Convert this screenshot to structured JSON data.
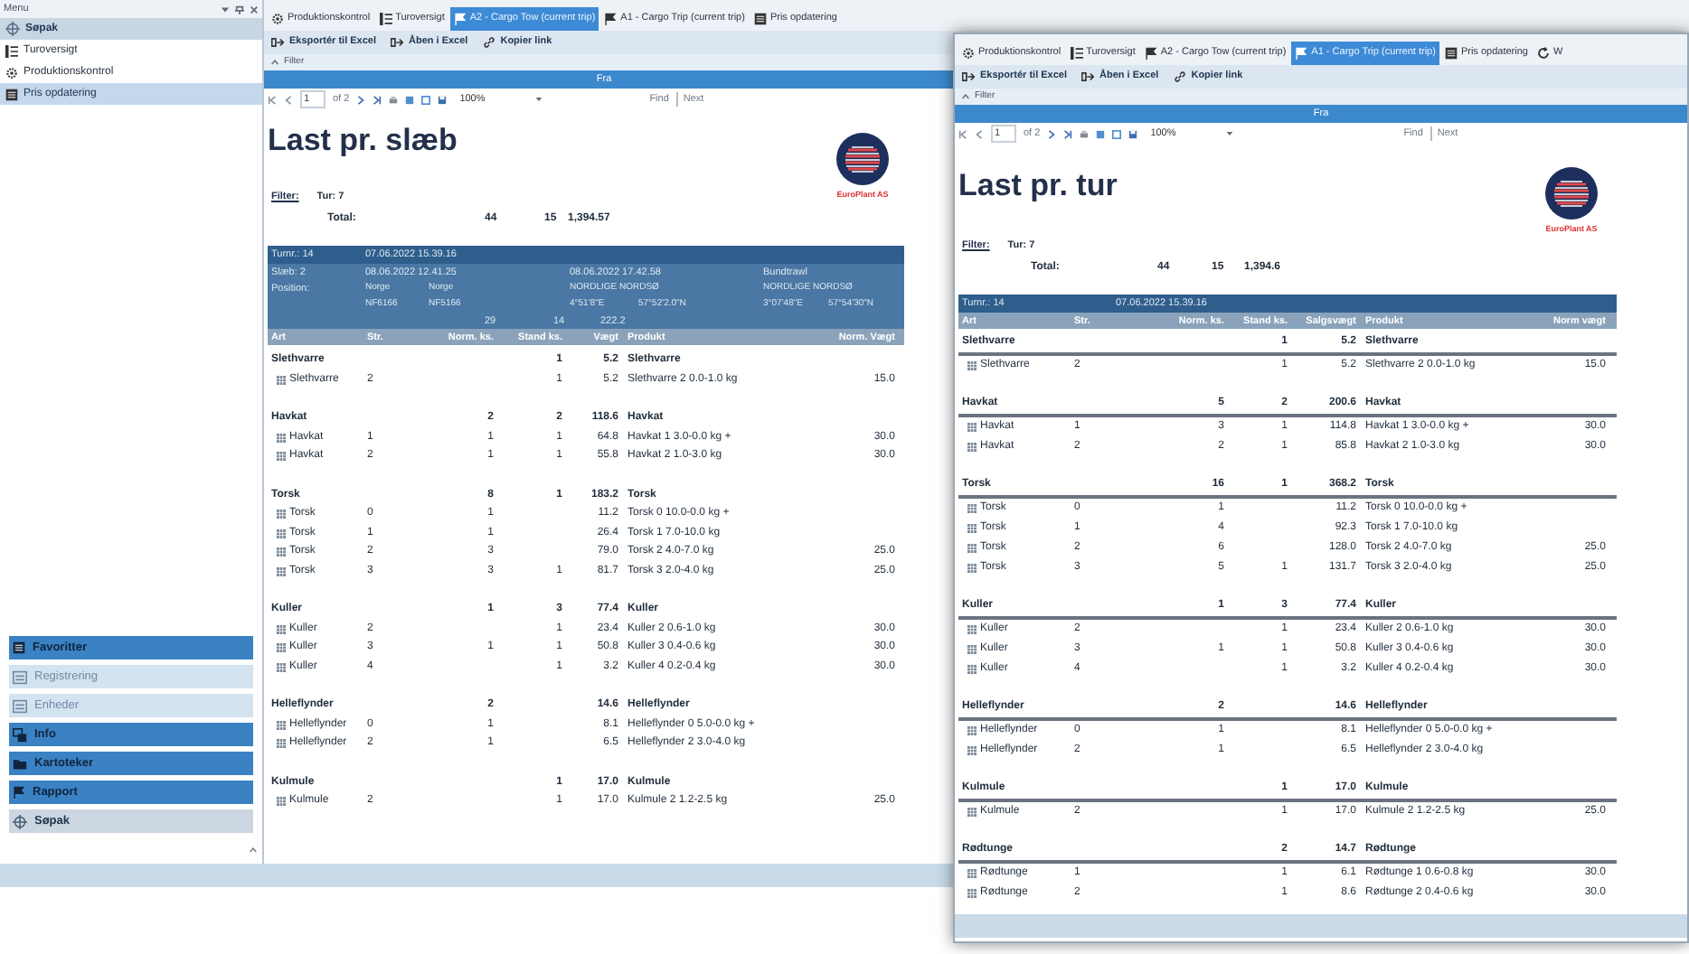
{
  "sidebar": {
    "title": "Menu",
    "group_title": "Søpak",
    "items": [
      {
        "label": "Turoversigt",
        "selected": false
      },
      {
        "label": "Produktionskontrol",
        "selected": false
      },
      {
        "label": "Pris opdatering",
        "selected": true
      }
    ],
    "nav": [
      {
        "label": "Favoritter",
        "disabled": false,
        "selected": false
      },
      {
        "label": "Registrering",
        "disabled": true,
        "selected": false
      },
      {
        "label": "Enheder",
        "disabled": true,
        "selected": false
      },
      {
        "label": "Info",
        "disabled": false,
        "selected": false
      },
      {
        "label": "Kartoteker",
        "disabled": false,
        "selected": false
      },
      {
        "label": "Rapport",
        "disabled": false,
        "selected": false
      },
      {
        "label": "Søpak",
        "disabled": false,
        "selected": true
      }
    ]
  },
  "main": {
    "tabs": [
      {
        "label": "Produktionskontrol",
        "selected": false
      },
      {
        "label": "Turoversigt",
        "selected": false
      },
      {
        "label": "A2 - Cargo Tow (current trip)",
        "selected": true
      },
      {
        "label": "A1 - Cargo Trip (current trip)",
        "selected": false
      },
      {
        "label": "Pris opdatering",
        "selected": false
      }
    ],
    "toolbar": [
      "Eksportér til Excel",
      "Åben i Excel",
      "Kopier link"
    ],
    "filter": "Filter",
    "band": "Fra",
    "report_toolbar": {
      "page": "1",
      "of": "of 2",
      "zoom": "100%",
      "find": "Find",
      "next": "Next"
    },
    "report": {
      "kind": "tow",
      "title": "Last pr. slæb",
      "filter_label": "Filter:",
      "filter_value": "Tur: 7",
      "logo_text": "EuroPlant AS",
      "group_rules": false,
      "total": {
        "label": "Total:",
        "values": [
          "44",
          "15",
          "1,394.57"
        ]
      },
      "header": [
        {
          "kind": "trip",
          "label": "Turnr.: 14",
          "time": "07.06.2022 15.39.16"
        },
        {
          "kind": "tow",
          "label": "Slæb: 2",
          "start": "08.06.2022 12.41.25",
          "end": "08.06.2022 17.42.58",
          "gear": "Bundtrawl"
        },
        {
          "kind": "position",
          "label": "Position:",
          "from": "Norge",
          "to": "Norge",
          "area_from": "NORDLIGE NORDSØ",
          "area_to": "NORDLIGE NORDSØ"
        },
        {
          "kind": "coords",
          "from": "NF6166",
          "to": "NF5166",
          "lon_from": "4°51'8\"E",
          "lat_from": "57°52'2.0\"N",
          "lon_to": "3°07'48\"E",
          "lat_to": "57°54'30\"N"
        },
        {
          "kind": "stats",
          "values": [
            "29",
            "14",
            "222.2"
          ]
        }
      ],
      "columns": [
        "Art",
        "Str.",
        "Norm. ks.",
        "Stand ks.",
        "Vægt",
        "Produkt",
        "Norm. Vægt"
      ],
      "groups": [
        {
          "name": "Slethvarre",
          "stand": "1",
          "weight": "5.2",
          "product": "Slethvarre",
          "rows": [
            {
              "art": "Slethvarre",
              "size": "2",
              "stand": "1",
              "weight": "5.2",
              "product": "Slethvarre 2 0.0-1.0 kg",
              "norm_weight": "15.0"
            }
          ]
        },
        {
          "name": "Havkat",
          "norm": "2",
          "stand": "2",
          "weight": "118.6",
          "product": "Havkat",
          "rows": [
            {
              "art": "Havkat",
              "size": "1",
              "norm": "1",
              "stand": "1",
              "weight": "64.8",
              "product": "Havkat 1 3.0-0.0 kg +",
              "norm_weight": "30.0"
            },
            {
              "art": "Havkat",
              "size": "2",
              "norm": "1",
              "stand": "1",
              "weight": "55.8",
              "product": "Havkat 2 1.0-3.0 kg",
              "norm_weight": "30.0"
            }
          ]
        },
        {
          "name": "Torsk",
          "norm": "8",
          "stand": "1",
          "weight": "183.2",
          "product": "Torsk",
          "rows": [
            {
              "art": "Torsk",
              "size": "0",
              "norm": "1",
              "weight": "11.2",
              "product": "Torsk 0 10.0-0.0 kg +"
            },
            {
              "art": "Torsk",
              "size": "1",
              "norm": "1",
              "weight": "26.4",
              "product": "Torsk 1 7.0-10.0 kg"
            },
            {
              "art": "Torsk",
              "size": "2",
              "norm": "3",
              "weight": "79.0",
              "product": "Torsk 2 4.0-7.0 kg",
              "norm_weight": "25.0"
            },
            {
              "art": "Torsk",
              "size": "3",
              "norm": "3",
              "stand": "1",
              "weight": "81.7",
              "product": "Torsk 3 2.0-4.0 kg",
              "norm_weight": "25.0"
            }
          ]
        },
        {
          "name": "Kuller",
          "norm": "1",
          "stand": "3",
          "weight": "77.4",
          "product": "Kuller",
          "rows": [
            {
              "art": "Kuller",
              "size": "2",
              "stand": "1",
              "weight": "23.4",
              "product": "Kuller 2 0.6-1.0 kg",
              "norm_weight": "30.0"
            },
            {
              "art": "Kuller",
              "size": "3",
              "norm": "1",
              "stand": "1",
              "weight": "50.8",
              "product": "Kuller 3 0.4-0.6 kg",
              "norm_weight": "30.0"
            },
            {
              "art": "Kuller",
              "size": "4",
              "stand": "1",
              "weight": "3.2",
              "product": "Kuller 4 0.2-0.4 kg",
              "norm_weight": "30.0"
            }
          ]
        },
        {
          "name": "Helleflynder",
          "norm": "2",
          "weight": "14.6",
          "product": "Helleflynder",
          "rows": [
            {
              "art": "Helleflynder",
              "size": "0",
              "norm": "1",
              "weight": "8.1",
              "product": "Helleflynder 0 5.0-0.0 kg +"
            },
            {
              "art": "Helleflynder",
              "size": "2",
              "norm": "1",
              "weight": "6.5",
              "product": "Helleflynder 2 3.0-4.0 kg"
            }
          ]
        },
        {
          "name": "Kulmule",
          "stand": "1",
          "weight": "17.0",
          "product": "Kulmule",
          "rows": [
            {
              "art": "Kulmule",
              "size": "2",
              "stand": "1",
              "weight": "17.0",
              "product": "Kulmule 2 1.2-2.5 kg",
              "norm_weight": "25.0"
            }
          ]
        }
      ]
    }
  },
  "window": {
    "tabs": [
      {
        "label": "Produktionskontrol",
        "selected": false
      },
      {
        "label": "Turoversigt",
        "selected": false
      },
      {
        "label": "A2 - Cargo Tow (current trip)",
        "selected": false
      },
      {
        "label": "A1 - Cargo Trip (current trip)",
        "selected": true
      },
      {
        "label": "Pris opdatering",
        "selected": false
      },
      {
        "label": "W",
        "selected": false
      }
    ],
    "toolbar": [
      "Eksportér til Excel",
      "Åben i Excel",
      "Kopier link"
    ],
    "filter": "Filter",
    "band": "Fra",
    "report_toolbar": {
      "page": "1",
      "of": "of 2",
      "zoom": "100%",
      "find": "Find",
      "next": "Next"
    },
    "report": {
      "kind": "trip",
      "title": "Last pr. tur",
      "filter_label": "Filter:",
      "filter_value": "Tur: 7",
      "logo_text": "EuroPlant AS",
      "group_rules": true,
      "total": {
        "label": "Total:",
        "values": [
          "44",
          "15",
          "1,394.6"
        ]
      },
      "header": [
        {
          "kind": "trip",
          "label": "Turnr.: 14",
          "time": "07.06.2022 15.39.16"
        }
      ],
      "columns": [
        "Art",
        "Str.",
        "Norm. ks.",
        "Stand ks.",
        "Salgsvægt",
        "Produkt",
        "Norm vægt"
      ],
      "groups": [
        {
          "name": "Slethvarre",
          "stand": "1",
          "weight": "5.2",
          "product": "Slethvarre",
          "rows": [
            {
              "art": "Slethvarre",
              "size": "2",
              "stand": "1",
              "weight": "5.2",
              "product": "Slethvarre 2 0.0-1.0 kg",
              "norm_weight": "15.0"
            }
          ]
        },
        {
          "name": "Havkat",
          "norm": "5",
          "stand": "2",
          "weight": "200.6",
          "product": "Havkat",
          "rows": [
            {
              "art": "Havkat",
              "size": "1",
              "norm": "3",
              "stand": "1",
              "weight": "114.8",
              "product": "Havkat 1 3.0-0.0 kg +",
              "norm_weight": "30.0"
            },
            {
              "art": "Havkat",
              "size": "2",
              "norm": "2",
              "stand": "1",
              "weight": "85.8",
              "product": "Havkat 2 1.0-3.0 kg",
              "norm_weight": "30.0"
            }
          ]
        },
        {
          "name": "Torsk",
          "norm": "16",
          "stand": "1",
          "weight": "368.2",
          "product": "Torsk",
          "rows": [
            {
              "art": "Torsk",
              "size": "0",
              "norm": "1",
              "weight": "11.2",
              "product": "Torsk 0 10.0-0.0 kg +"
            },
            {
              "art": "Torsk",
              "size": "1",
              "norm": "4",
              "weight": "92.3",
              "product": "Torsk 1 7.0-10.0 kg"
            },
            {
              "art": "Torsk",
              "size": "2",
              "norm": "6",
              "weight": "128.0",
              "product": "Torsk 2 4.0-7.0 kg",
              "norm_weight": "25.0"
            },
            {
              "art": "Torsk",
              "size": "3",
              "norm": "5",
              "stand": "1",
              "weight": "131.7",
              "product": "Torsk 3 2.0-4.0 kg",
              "norm_weight": "25.0"
            }
          ]
        },
        {
          "name": "Kuller",
          "norm": "1",
          "stand": "3",
          "weight": "77.4",
          "product": "Kuller",
          "rows": [
            {
              "art": "Kuller",
              "size": "2",
              "stand": "1",
              "weight": "23.4",
              "product": "Kuller 2 0.6-1.0 kg",
              "norm_weight": "30.0"
            },
            {
              "art": "Kuller",
              "size": "3",
              "norm": "1",
              "stand": "1",
              "weight": "50.8",
              "product": "Kuller 3 0.4-0.6 kg",
              "norm_weight": "30.0"
            },
            {
              "art": "Kuller",
              "size": "4",
              "stand": "1",
              "weight": "3.2",
              "product": "Kuller 4 0.2-0.4 kg",
              "norm_weight": "30.0"
            }
          ]
        },
        {
          "name": "Helleflynder",
          "norm": "2",
          "weight": "14.6",
          "product": "Helleflynder",
          "rows": [
            {
              "art": "Helleflynder",
              "size": "0",
              "norm": "1",
              "weight": "8.1",
              "product": "Helleflynder 0 5.0-0.0 kg +"
            },
            {
              "art": "Helleflynder",
              "size": "2",
              "norm": "1",
              "weight": "6.5",
              "product": "Helleflynder 2 3.0-4.0 kg"
            }
          ]
        },
        {
          "name": "Kulmule",
          "stand": "1",
          "weight": "17.0",
          "product": "Kulmule",
          "rows": [
            {
              "art": "Kulmule",
              "size": "2",
              "stand": "1",
              "weight": "17.0",
              "product": "Kulmule 2 1.2-2.5 kg",
              "norm_weight": "25.0"
            }
          ]
        },
        {
          "name": "Rødtunge",
          "stand": "2",
          "weight": "14.7",
          "product": "Rødtunge",
          "rows": [
            {
              "art": "Rødtunge",
              "size": "1",
              "stand": "1",
              "weight": "6.1",
              "product": "Rødtunge 1 0.6-0.8 kg",
              "norm_weight": "30.0"
            },
            {
              "art": "Rødtunge",
              "size": "2",
              "stand": "1",
              "weight": "8.6",
              "product": "Rødtunge 2 0.4-0.6 kg",
              "norm_weight": "30.0"
            }
          ]
        }
      ]
    }
  }
}
